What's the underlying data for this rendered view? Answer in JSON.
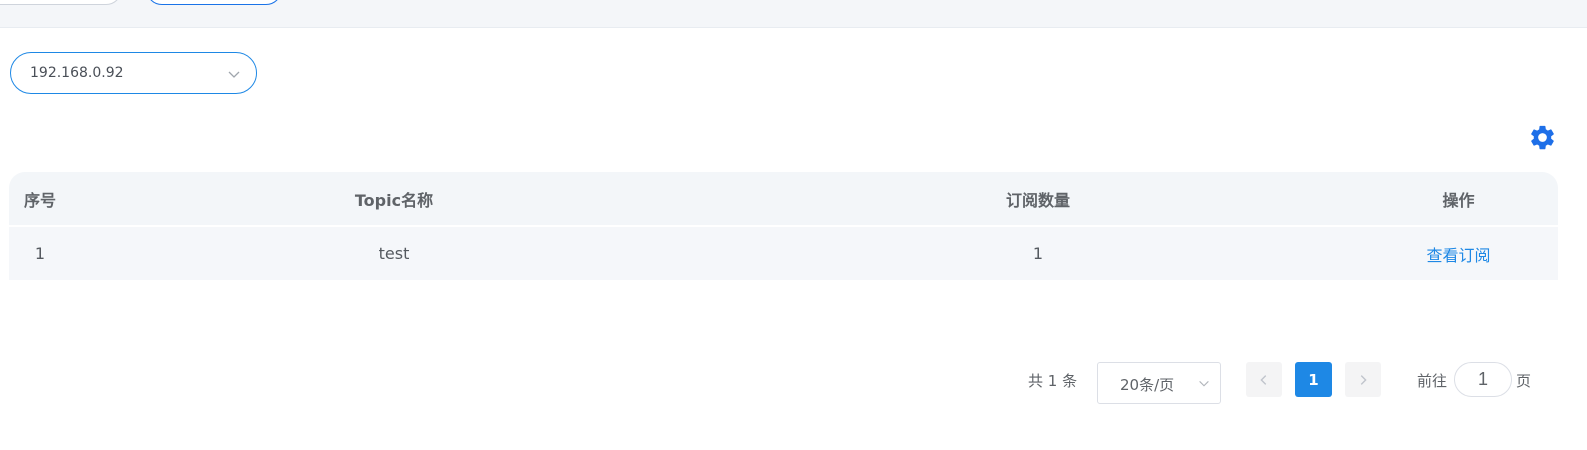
{
  "host_select": {
    "value": "192.168.0.92"
  },
  "icons": {
    "settings": "gear-icon",
    "dropdown": "chevron-down-icon",
    "prev": "chevron-left-icon",
    "next": "chevron-right-icon"
  },
  "colors": {
    "accent": "#1e88e5",
    "header_bg": "#f3f6f9",
    "row_bg": "#f5f7fa"
  },
  "table": {
    "headers": [
      "序号",
      "Topic名称",
      "订阅数量",
      "操作"
    ],
    "rows": [
      {
        "index": "1",
        "topic": "test",
        "count": "1",
        "action": "查看订阅"
      }
    ]
  },
  "pagination": {
    "total_text": "共 1 条",
    "page_size": "20条/页",
    "current_page": "1",
    "goto_label": "前往",
    "goto_value": "1",
    "goto_suffix": "页"
  }
}
